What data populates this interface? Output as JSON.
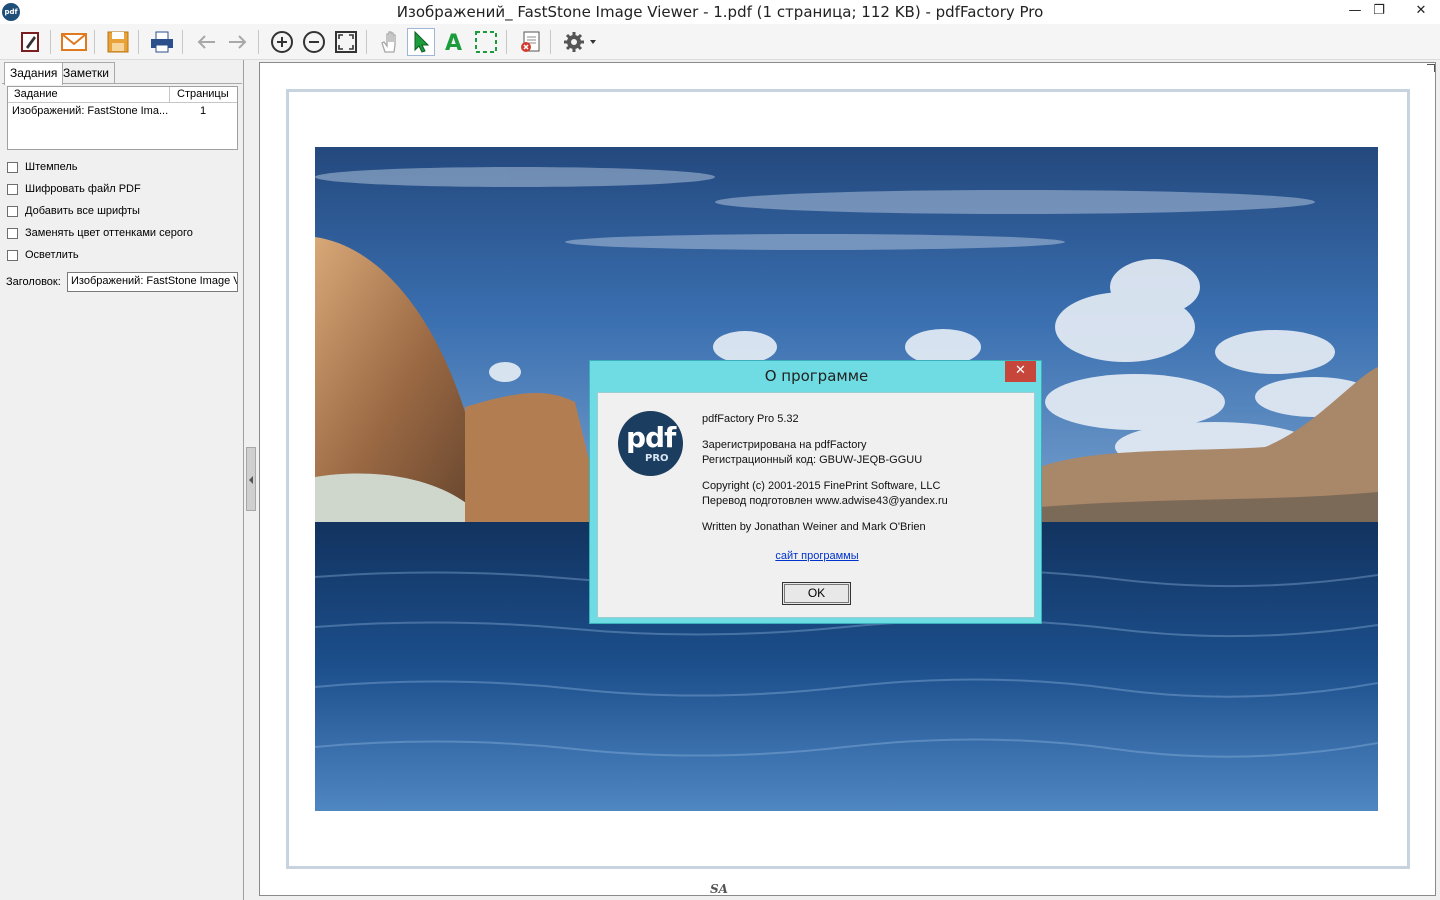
{
  "window": {
    "app_logo": "pdf",
    "title": "Изображений_ FastStone Image Viewer - 1.pdf (1 страница; 112 KB) - pdfFactory Pro",
    "minimize": "—",
    "maximize": "❐",
    "close": "✕"
  },
  "toolbar": {
    "icons": [
      "edit-icon",
      "email-icon",
      "save-icon",
      "print-icon",
      "back-icon",
      "forward-icon",
      "zoom-in-icon",
      "zoom-out-icon",
      "fit-page-icon",
      "hand-icon",
      "select-arrow-icon",
      "text-select-icon",
      "marquee-select-icon",
      "delete-page-icon",
      "settings-icon"
    ]
  },
  "left_panel": {
    "tabs": [
      "Задания",
      "Заметки"
    ],
    "job_list": {
      "headers": [
        "Задание",
        "Страницы"
      ],
      "rows": [
        {
          "name": "Изображений: FastStone Ima...",
          "pages": "1"
        }
      ]
    },
    "options": [
      "Штемпель",
      "Шифровать файл PDF",
      "Добавить все шрифты",
      "Заменять цвет оттенками серого",
      "Осветлить"
    ],
    "title_label": "Заголовок:",
    "title_value": "Изображений: FastStone Image V"
  },
  "preview": {
    "watermark": "SA"
  },
  "about_dialog": {
    "title": "О программе",
    "close": "✕",
    "logo_big": "pdf",
    "logo_small": "PRO",
    "product": "pdfFactory Pro 5.32",
    "registered": "Зарегистрирована на pdfFactory",
    "reg_code": "Регистрационный код:  GBUW-JEQB-GGUU",
    "copyright": "Copyright (c) 2001-2015 FinePrint Software, LLC",
    "translation": "Перевод подготовлен www.adwise43@yandex.ru",
    "authors": "Written by Jonathan Weiner and Mark O'Brien",
    "link": "сайт программы",
    "ok": "OK"
  },
  "colors": {
    "dialog_frame": "#6fdbe3",
    "dialog_close": "#c7463c",
    "link": "#0033cc",
    "sea": "#1c4f8c"
  }
}
